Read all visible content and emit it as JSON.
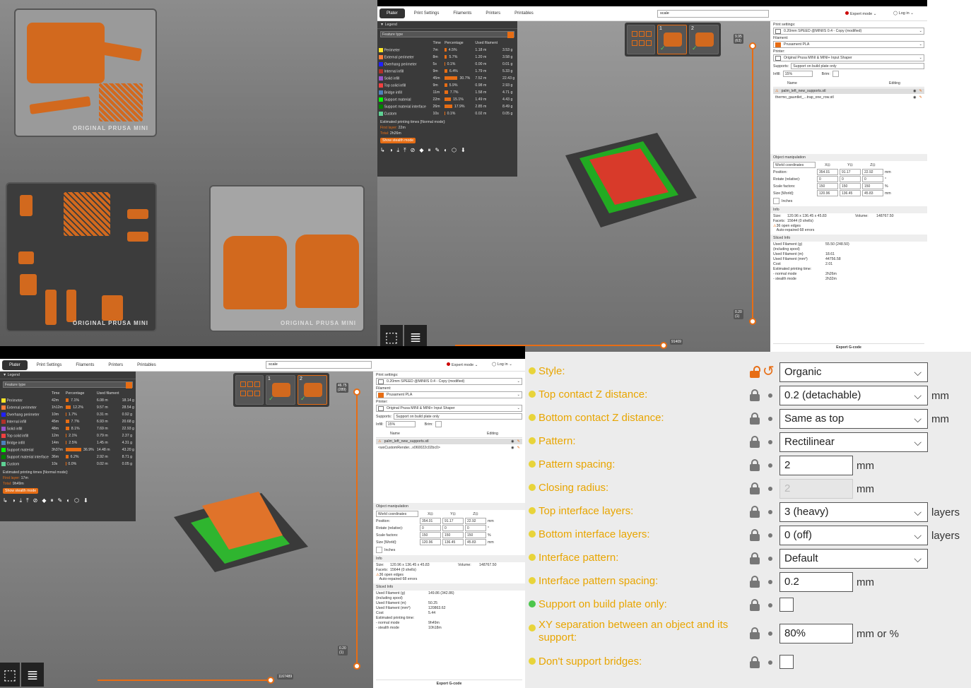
{
  "q1_photo": {
    "bed_label_1": "ORIGINAL PRUSA MINI",
    "bed_label_2": "ORIGINAL PRUSA MINI",
    "bed_label_3": "ORIGINAL PRUSA MINI"
  },
  "slicer_top": {
    "tabs": [
      "Plater",
      "Print Settings",
      "Filaments",
      "Printers",
      "Printables"
    ],
    "search_value": "scale",
    "mode": "Expert mode",
    "login": "Log in",
    "legend": {
      "title": "Legend",
      "feature_type": "Feature type",
      "columns": [
        "Time",
        "Percentage",
        "Used filament"
      ],
      "rows": [
        {
          "name": "Perimeter",
          "color": "#ffe627",
          "time": "7m",
          "pct": "4.5%",
          "len": "1.18 m",
          "g": "3.53 g",
          "bar": 4.5
        },
        {
          "name": "External perimeter",
          "color": "#ff7d38",
          "time": "8m",
          "pct": "5.7%",
          "len": "1.20 m",
          "g": "3.58 g",
          "bar": 5.7
        },
        {
          "name": "Overhang perimeter",
          "color": "#1f1fff",
          "time": "5s",
          "pct": "0.1%",
          "len": "0.00 m",
          "g": "0.01 g",
          "bar": 0.1
        },
        {
          "name": "Internal infill",
          "color": "#b03029",
          "time": "9m",
          "pct": "6.4%",
          "len": "1.79 m",
          "g": "5.33 g",
          "bar": 6.4
        },
        {
          "name": "Solid infill",
          "color": "#9654cc",
          "time": "45m",
          "pct": "30.7%",
          "len": "7.52 m",
          "g": "22.43 g",
          "bar": 30.7
        },
        {
          "name": "Top solid infill",
          "color": "#f04040",
          "time": "9m",
          "pct": "5.9%",
          "len": "0.98 m",
          "g": "2.93 g",
          "bar": 5.9
        },
        {
          "name": "Bridge infill",
          "color": "#4d80ba",
          "time": "11m",
          "pct": "7.7%",
          "len": "1.58 m",
          "g": "4.71 g",
          "bar": 7.7
        },
        {
          "name": "Support material",
          "color": "#00ff00",
          "time": "22m",
          "pct": "15.1%",
          "len": "1.49 m",
          "g": "4.43 g",
          "bar": 15.1
        },
        {
          "name": "Support material interface",
          "color": "#008000",
          "time": "26m",
          "pct": "17.9%",
          "len": "2.85 m",
          "g": "8.49 g",
          "bar": 17.9
        },
        {
          "name": "Custom",
          "color": "#5ed194",
          "time": "10s",
          "pct": "0.1%",
          "len": "0.02 m",
          "g": "0.05 g",
          "bar": 0.1
        }
      ],
      "est_title": "Estimated printing times [Normal mode]:",
      "first_layer_k": "First layer:",
      "first_layer_v": "22m",
      "total_k": "Total:",
      "total_v": "2h26m",
      "stealth": "Show stealth mode"
    },
    "layer_top": "9.95",
    "layer_top2": "(63)",
    "layer_bot": "0.20",
    "layer_bot2": "(1)",
    "hslider_value": "91409",
    "sidebar": {
      "print_settings_lbl": "Print settings:",
      "print_settings": "0.20mm SPEED @MINIIS 0.4 - Copy (modified)",
      "filament_lbl": "Filament:",
      "filament": "Prusament PLA",
      "printer_lbl": "Printer:",
      "printer": "Original Prusa MINI & MINI+ Input Shaper",
      "supports_lbl": "Supports:",
      "supports": "Support on build plate only",
      "infill_lbl": "Infill:",
      "infill": "15%",
      "brim_lbl": "Brim:",
      "col_name": "Name",
      "col_editing": "Editing",
      "objects": [
        "palm_left_new_supports.stl",
        "thermo_gauntlet_...trap_one_row.stl"
      ],
      "objman": "Object manipulation",
      "coords": "World coordinates",
      "pos_lbl": "Position:",
      "pos": [
        "354.01",
        "91.17",
        "22.92"
      ],
      "rot_lbl": "Rotate (relative):",
      "rot": [
        "0",
        "0",
        "0"
      ],
      "scale_lbl": "Scale factors:",
      "scale": [
        "150",
        "150",
        "150"
      ],
      "size_lbl": "Size [World]:",
      "size": [
        "120.96",
        "136.45",
        "45.83"
      ],
      "unit_mm": "mm",
      "unit_deg": "°",
      "unit_pct": "%",
      "inches": "Inches",
      "info": "Info",
      "size_k": "Size:",
      "size_v": "120.96 x 136.45 x 45.83",
      "volume_k": "Volume:",
      "volume_v": "148767.50",
      "facets_k": "Facets:",
      "facets_v": "15644 (0 shells)",
      "open_edges": "36 open edges",
      "repaired": "Auto-repaired 68 errors",
      "sliced": "Sliced Info",
      "used_g_k": "Used Filament (g)",
      "used_g_k2": "(including spool)",
      "used_g_v": "55.50 (248.50)",
      "used_m_k": "Used Filament (m)",
      "used_m_v": "18.61",
      "used_mm3_k": "Used Filament (mm³)",
      "used_mm3_v": "44756.58",
      "cost_k": "Cost",
      "cost_v": "2.01",
      "est_k": "Estimated printing time:",
      "normal_k": "- normal mode",
      "normal_v": "2h26m",
      "stealth_k": "- stealth mode",
      "stealth_v": "2h32m",
      "export": "Export G-code"
    }
  },
  "slicer_bottom": {
    "tabs": [
      "Plater",
      "Print Settings",
      "Filaments",
      "Printers",
      "Printables"
    ],
    "search_value": "scale",
    "mode": "Expert mode",
    "login": "Log in",
    "legend": {
      "title": "Legend",
      "feature_type": "Feature type",
      "columns": [
        "Time",
        "Percentage",
        "Used filament"
      ],
      "rows": [
        {
          "name": "Perimeter",
          "color": "#ffe627",
          "time": "42m",
          "pct": "7.1%",
          "len": "6.08 m",
          "g": "18.14 g",
          "bar": 7.1
        },
        {
          "name": "External perimeter",
          "color": "#ff7d38",
          "time": "1h12m",
          "pct": "12.2%",
          "len": "9.57 m",
          "g": "28.54 g",
          "bar": 12.2
        },
        {
          "name": "Overhang perimeter",
          "color": "#1f1fff",
          "time": "10m",
          "pct": "1.7%",
          "len": "0.31 m",
          "g": "0.92 g",
          "bar": 1.7
        },
        {
          "name": "Internal infill",
          "color": "#b03029",
          "time": "45m",
          "pct": "7.7%",
          "len": "6.93 m",
          "g": "20.68 g",
          "bar": 7.7
        },
        {
          "name": "Solid infill",
          "color": "#9654cc",
          "time": "48m",
          "pct": "8.1%",
          "len": "7.69 m",
          "g": "22.93 g",
          "bar": 8.1
        },
        {
          "name": "Top solid infill",
          "color": "#f04040",
          "time": "12m",
          "pct": "2.1%",
          "len": "0.79 m",
          "g": "2.37 g",
          "bar": 2.1
        },
        {
          "name": "Bridge infill",
          "color": "#4d80ba",
          "time": "14m",
          "pct": "2.5%",
          "len": "1.45 m",
          "g": "4.31 g",
          "bar": 2.5
        },
        {
          "name": "Support material",
          "color": "#00ff00",
          "time": "3h37m",
          "pct": "36.9%",
          "len": "14.48 m",
          "g": "43.20 g",
          "bar": 36.9
        },
        {
          "name": "Support material interface",
          "color": "#008000",
          "time": "36m",
          "pct": "6.2%",
          "len": "2.92 m",
          "g": "8.71 g",
          "bar": 6.2
        },
        {
          "name": "Custom",
          "color": "#5ed194",
          "time": "10s",
          "pct": "0.0%",
          "len": "0.02 m",
          "g": "0.05 g",
          "bar": 0.0
        }
      ],
      "est_title": "Estimated printing times [Normal mode]:",
      "first_layer_k": "First layer:",
      "first_layer_v": "17m",
      "total_k": "Total:",
      "total_v": "9h49m",
      "stealth": "Show stealth mode"
    },
    "layer_top": "46.75",
    "layer_top2": "(289)",
    "layer_bot": "0.20",
    "layer_bot2": "(1)",
    "hslider_value": "1167489",
    "sidebar": {
      "print_settings_lbl": "Print settings:",
      "print_settings": "0.20mm SPEED @MINIIS 0.4 - Copy (modified)",
      "filament_lbl": "Filament:",
      "filament": "Prusament PLA",
      "printer_lbl": "Printer:",
      "printer": "Original Prusa MINI & MINI+ Input Shaper",
      "supports_lbl": "Supports:",
      "supports": "Support on build plate only",
      "infill_lbl": "Infill:",
      "infill": "15%",
      "brim_lbl": "Brim:",
      "col_name": "Name",
      "col_editing": "Editing",
      "objects": [
        "palm_left_new_supports.stl",
        "<wxCustomRender...x060022c02bc0>"
      ],
      "objman": "Object manipulation",
      "coords": "World coordinates",
      "pos_lbl": "Position:",
      "pos": [
        "354.01",
        "91.17",
        "22.92"
      ],
      "rot_lbl": "Rotate (relative):",
      "rot": [
        "0",
        "0",
        "0"
      ],
      "scale_lbl": "Scale factors:",
      "scale": [
        "150",
        "150",
        "150"
      ],
      "size_lbl": "Size [World]:",
      "size": [
        "120.96",
        "136.45",
        "45.83"
      ],
      "unit_mm": "mm",
      "unit_deg": "°",
      "unit_pct": "%",
      "inches": "Inches",
      "info": "Info",
      "size_k": "Size:",
      "size_v": "120.96 x 136.45 x 45.83",
      "volume_k": "Volume:",
      "volume_v": "148767.50",
      "facets_k": "Facets:",
      "facets_v": "15644 (0 shells)",
      "open_edges": "36 open edges",
      "repaired": "Auto-repaired 68 errors",
      "sliced": "Sliced Info",
      "used_g_k": "Used Filament (g)",
      "used_g_k2": "(including spool)",
      "used_g_v": "149.86 (342.86)",
      "used_m_k": "Used Filament (m)",
      "used_m_v": "50.25",
      "used_mm3_k": "Used Filament (mm³)",
      "used_mm3_v": "120863.62",
      "cost_k": "Cost",
      "cost_v": "5.44",
      "est_k": "Estimated printing time:",
      "normal_k": "- normal mode",
      "normal_v": "9h49m",
      "stealth_k": "- stealth mode",
      "stealth_v": "10h18m",
      "export": "Export G-code"
    }
  },
  "support_settings": {
    "rows": [
      {
        "label": "Style:",
        "type": "select",
        "value": "Organic",
        "unit": "",
        "lock": "open",
        "dot": "yellow"
      },
      {
        "label": "Top contact Z distance:",
        "type": "select",
        "value": "0.2 (detachable)",
        "unit": "mm",
        "lock": "closed",
        "dot": "yellow"
      },
      {
        "label": "Bottom contact Z distance:",
        "type": "select",
        "value": "Same as top",
        "unit": "mm",
        "lock": "closed",
        "dot": "yellow"
      },
      {
        "label": "Pattern:",
        "type": "select",
        "value": "Rectilinear",
        "unit": "",
        "lock": "closed",
        "dot": "yellow"
      },
      {
        "label": "Pattern spacing:",
        "type": "text",
        "value": "2",
        "unit": "mm",
        "lock": "closed",
        "dot": "yellow"
      },
      {
        "label": "Closing radius:",
        "type": "text-disabled",
        "value": "2",
        "unit": "mm",
        "lock": "closed",
        "dot": "yellow"
      },
      {
        "label": "Top interface layers:",
        "type": "select",
        "value": "3 (heavy)",
        "unit": "layers",
        "lock": "closed",
        "dot": "yellow"
      },
      {
        "label": "Bottom interface layers:",
        "type": "select",
        "value": "0 (off)",
        "unit": "layers",
        "lock": "closed",
        "dot": "yellow"
      },
      {
        "label": "Interface pattern:",
        "type": "select",
        "value": "Default",
        "unit": "",
        "lock": "closed",
        "dot": "yellow"
      },
      {
        "label": "Interface pattern spacing:",
        "type": "text",
        "value": "0.2",
        "unit": "mm",
        "lock": "closed",
        "dot": "yellow"
      },
      {
        "label": "Support on build plate only:",
        "type": "checkbox",
        "value": "",
        "unit": "",
        "lock": "closed",
        "dot": "green"
      },
      {
        "label": "XY separation between an object and its support:",
        "type": "text",
        "value": "80%",
        "unit": "mm or %",
        "lock": "closed",
        "dot": "yellow"
      },
      {
        "label": "Don't support bridges:",
        "type": "checkbox",
        "value": "",
        "unit": "",
        "lock": "closed",
        "dot": "yellow"
      }
    ],
    "undo_icon": "↺"
  }
}
